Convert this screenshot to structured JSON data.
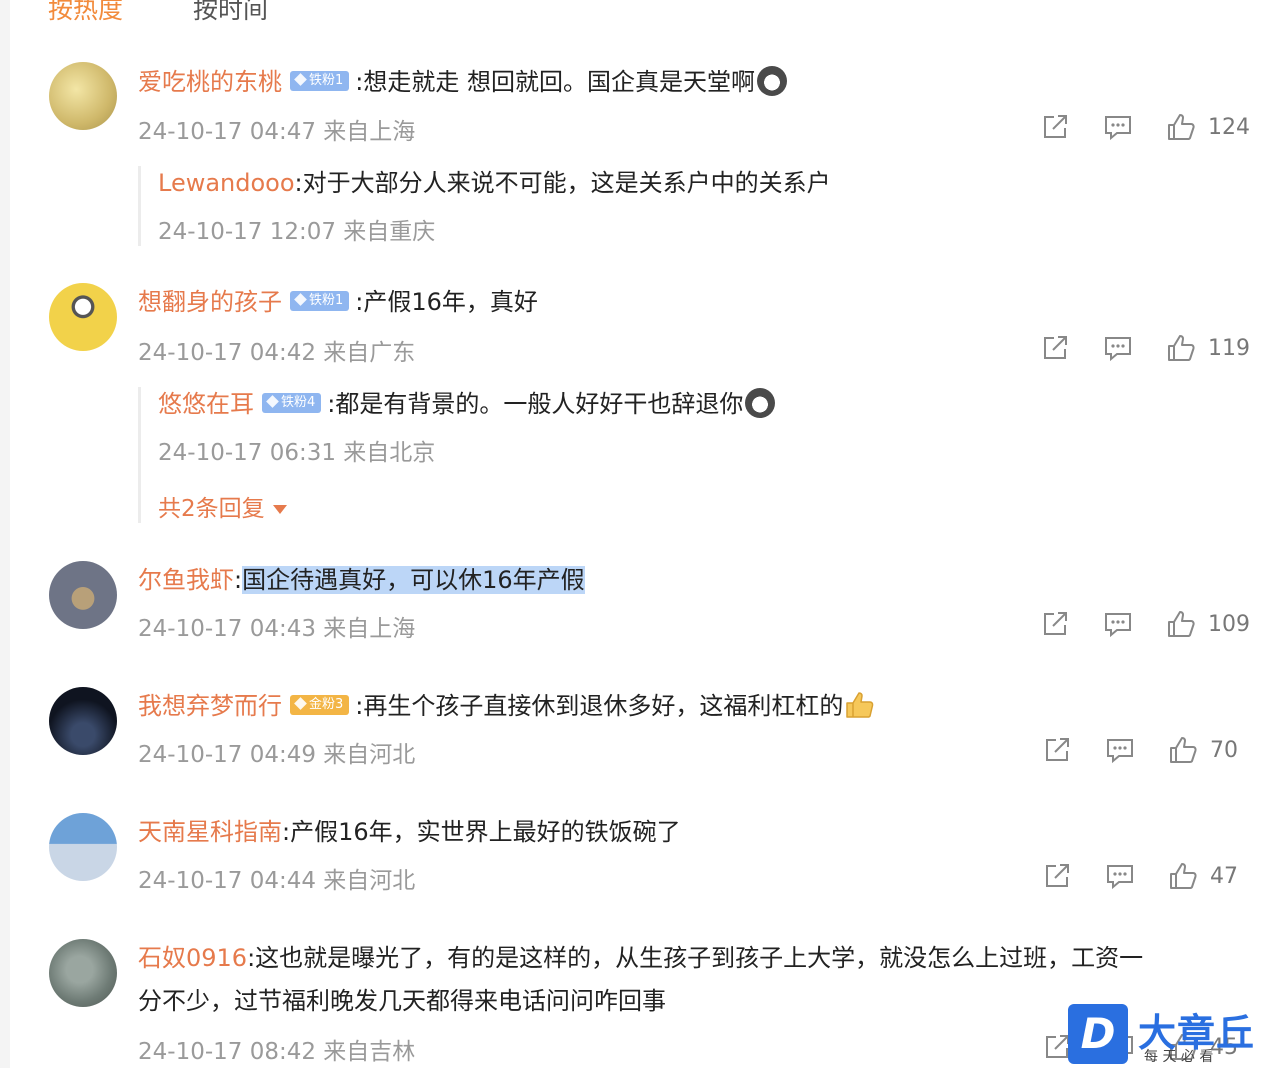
{
  "tabs": {
    "hot": "按热度",
    "time": "按时间"
  },
  "comments": [
    {
      "user": "爱吃桃的东桃",
      "badge": "铁粉1",
      "text": ":想走就走 想回就回。国企真是天堂啊",
      "time": "24-10-17 04:47 来自上海",
      "likes": "124",
      "reply": {
        "user": "Lewandooo",
        "text": ":对于大部分人来说不可能，这是关系户中的关系户",
        "time": "24-10-17 12:07 来自重庆"
      }
    },
    {
      "user": "想翻身的孩子",
      "badge": "铁粉1",
      "text": ":产假16年，真好",
      "time": "24-10-17 04:42 来自广东",
      "likes": "119",
      "reply": {
        "user": "悠悠在耳",
        "badge": "铁粉4",
        "text": ":都是有背景的。一般人好好干也辞退你",
        "time": "24-10-17 06:31 来自北京",
        "more": "共2条回复"
      }
    },
    {
      "user": "尔鱼我虾",
      "text_prefix": ":",
      "text": "国企待遇真好，可以休16年产假",
      "time": "24-10-17 04:43 来自上海",
      "likes": "109"
    },
    {
      "user": "我想弃梦而行",
      "badge": "金粉3",
      "text": ":再生个孩子直接休到退休多好，这福利杠杠的",
      "time": "24-10-17 04:49 来自河北",
      "likes": "70"
    },
    {
      "user": "天南星科指南",
      "text": ":产假16年，实世界上最好的铁饭碗了",
      "time": "24-10-17 04:44 来自河北",
      "likes": "47"
    },
    {
      "user": "石奴0916",
      "text": ":这也就是曝光了，有的是这样的，从生孩子到孩子上大学，就没怎么上过班，工资一",
      "text2": "分不少，过节福利晚发几天都得来电话问问咋回事",
      "time": "24-10-17 08:42 来自吉林",
      "likes": "45"
    }
  ],
  "watermark": {
    "logo": "D",
    "name": "大章丘",
    "sub": "每    天    必    看"
  }
}
